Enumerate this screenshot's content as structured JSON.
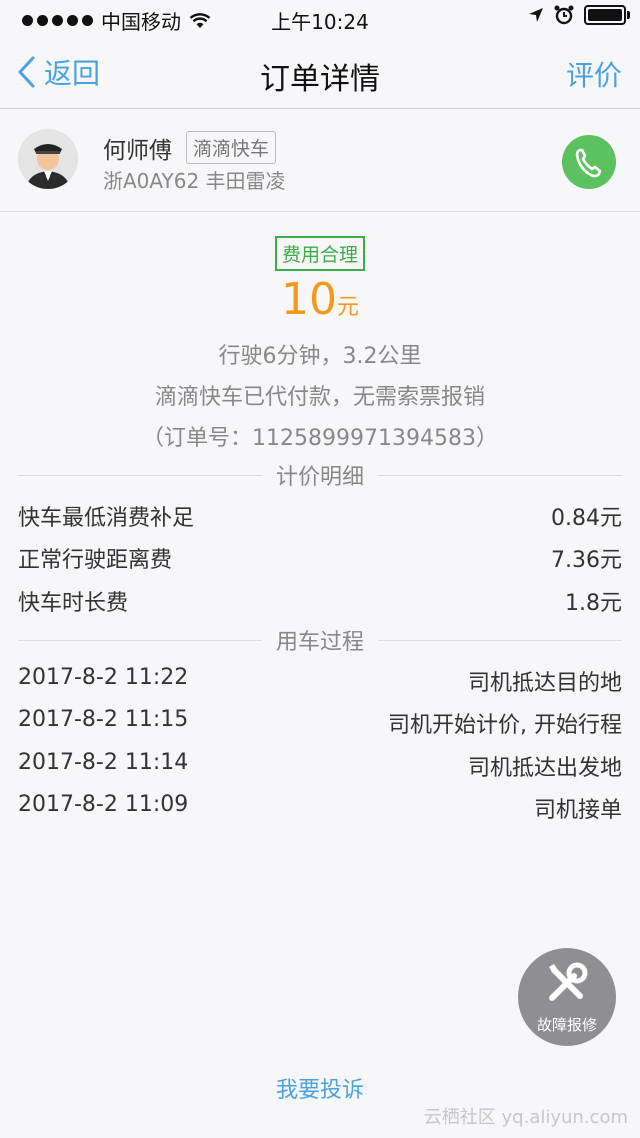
{
  "status_bar": {
    "carrier": "中国移动",
    "time": "上午10:24"
  },
  "nav": {
    "back_label": "返回",
    "title": "订单详情",
    "rate_label": "评价"
  },
  "driver": {
    "name": "何师傅",
    "service_tag": "滴滴快车",
    "plate_car": "浙A0AY62 丰田雷凌"
  },
  "fare": {
    "badge": "费用合理",
    "amount": "10",
    "unit": "元",
    "trip_info": "行驶6分钟，3.2公里",
    "payment_note": "滴滴快车已代付款，无需索票报销",
    "order_no": "（订单号：1125899971394583）"
  },
  "pricing": {
    "section_title": "计价明细",
    "items": [
      {
        "label": "快车最低消费补足",
        "value": "0.84元"
      },
      {
        "label": "正常行驶距离费",
        "value": "7.36元"
      },
      {
        "label": "快车时长费",
        "value": "1.8元"
      }
    ]
  },
  "process": {
    "section_title": "用车过程",
    "items": [
      {
        "time": "2017-8-2 11:22",
        "event": "司机抵达目的地"
      },
      {
        "time": "2017-8-2 11:15",
        "event": "司机开始计价, 开始行程"
      },
      {
        "time": "2017-8-2 11:14",
        "event": "司机抵达出发地"
      },
      {
        "time": "2017-8-2 11:09",
        "event": "司机接单"
      }
    ]
  },
  "fault_report_label": "故障报修",
  "complain_label": "我要投诉",
  "watermark": "云栖社区 yq.aliyun.com",
  "colors": {
    "accent": "#4aa3e0",
    "price": "#f39a1e",
    "badge": "#3cad48",
    "phone": "#5cc15f"
  }
}
